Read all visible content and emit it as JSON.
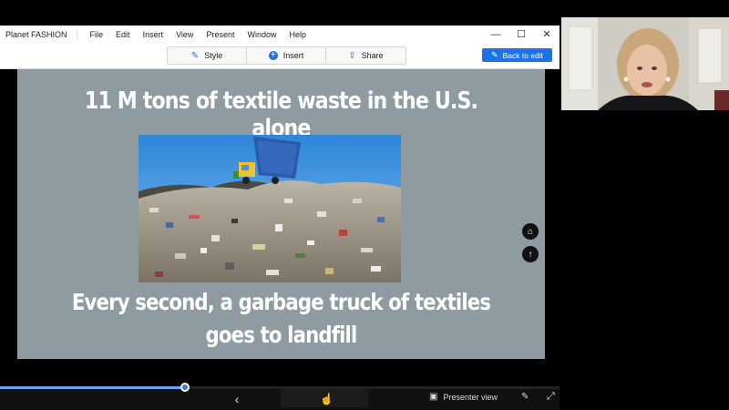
{
  "app": {
    "title": "Planet FASHION",
    "menu": [
      "File",
      "Edit",
      "Insert",
      "View",
      "Present",
      "Window",
      "Help"
    ],
    "window_controls": {
      "minimize": "—",
      "maximize": "☐",
      "close": "✕"
    }
  },
  "toolbar": {
    "style_label": "Style",
    "insert_label": "Insert",
    "share_label": "Share",
    "back_to_edit_label": "Back to edit",
    "accent_color": "#1a73e8"
  },
  "slide": {
    "title": "11 M tons of textile waste in the U.S. alone",
    "subtitle": "Every second, a garbage truck of textiles goes to landfill",
    "background_color": "#8e9ba0",
    "image": "landfill-garbage-truck-photo"
  },
  "side_buttons": {
    "home_icon": "⌂",
    "up_icon": "↑"
  },
  "bottom_bar": {
    "prev_icon": "‹",
    "presenter_view_label": "Presenter view",
    "pen_icon": "✎",
    "fullscreen_icon": "⤢",
    "progress": 0.33
  },
  "webcam": {
    "image": "presenter-webcam-feed"
  }
}
